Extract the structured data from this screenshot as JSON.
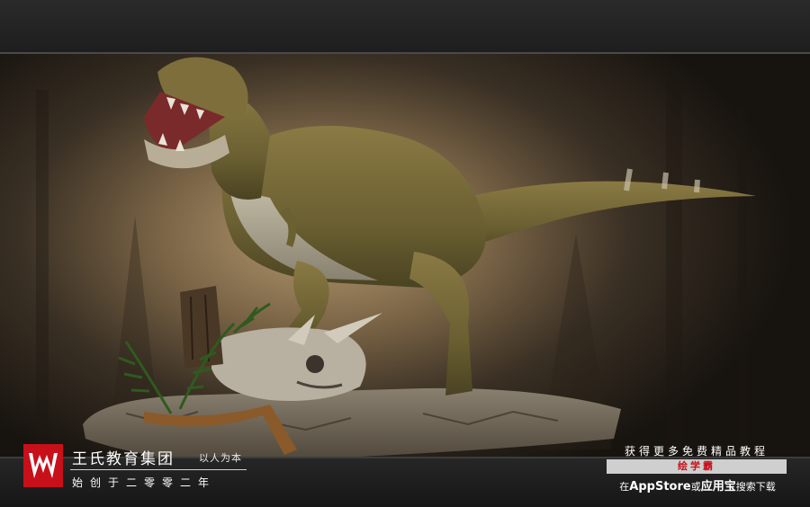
{
  "brand": {
    "name": "王氏教育集团",
    "slogan": "以人为本",
    "founded": "始创于二零零二年",
    "logo_color": "#c8101a"
  },
  "promo": {
    "line1": "获得更多免费精品教程",
    "app_name": "绘学霸",
    "line2_prefix": "在",
    "store1": "AppStore",
    "line2_or": "或",
    "store2": "应用宝",
    "line2_suffix": "搜索下载"
  },
  "image": {
    "subject": "t-rex-sculpture"
  }
}
